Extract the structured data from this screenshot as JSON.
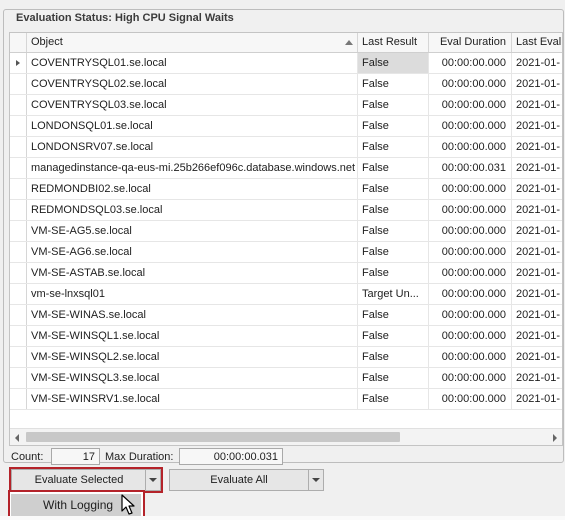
{
  "group": {
    "title": "Evaluation Status: High CPU Signal Waits"
  },
  "grid": {
    "columns": {
      "object": "Object",
      "last_result": "Last Result",
      "eval_duration": "Eval Duration",
      "last_eval": "Last Eval"
    },
    "rows": [
      {
        "object": "COVENTRYSQL01.se.local",
        "last_result": "False",
        "eval_duration": "00:00:00.000",
        "last_eval": "2021-01-"
      },
      {
        "object": "COVENTRYSQL02.se.local",
        "last_result": "False",
        "eval_duration": "00:00:00.000",
        "last_eval": "2021-01-"
      },
      {
        "object": "COVENTRYSQL03.se.local",
        "last_result": "False",
        "eval_duration": "00:00:00.000",
        "last_eval": "2021-01-"
      },
      {
        "object": "LONDONSQL01.se.local",
        "last_result": "False",
        "eval_duration": "00:00:00.000",
        "last_eval": "2021-01-"
      },
      {
        "object": "LONDONSRV07.se.local",
        "last_result": "False",
        "eval_duration": "00:00:00.000",
        "last_eval": "2021-01-"
      },
      {
        "object": "managedinstance-qa-eus-mi.25b266ef096c.database.windows.net",
        "last_result": "False",
        "eval_duration": "00:00:00.031",
        "last_eval": "2021-01-"
      },
      {
        "object": "REDMONDBI02.se.local",
        "last_result": "False",
        "eval_duration": "00:00:00.000",
        "last_eval": "2021-01-"
      },
      {
        "object": "REDMONDSQL03.se.local",
        "last_result": "False",
        "eval_duration": "00:00:00.000",
        "last_eval": "2021-01-"
      },
      {
        "object": "VM-SE-AG5.se.local",
        "last_result": "False",
        "eval_duration": "00:00:00.000",
        "last_eval": "2021-01-"
      },
      {
        "object": "VM-SE-AG6.se.local",
        "last_result": "False",
        "eval_duration": "00:00:00.000",
        "last_eval": "2021-01-"
      },
      {
        "object": "VM-SE-ASTAB.se.local",
        "last_result": "False",
        "eval_duration": "00:00:00.000",
        "last_eval": "2021-01-"
      },
      {
        "object": "vm-se-lnxsql01",
        "last_result": "Target Un...",
        "eval_duration": "00:00:00.000",
        "last_eval": "2021-01-"
      },
      {
        "object": "VM-SE-WINAS.se.local",
        "last_result": "False",
        "eval_duration": "00:00:00.000",
        "last_eval": "2021-01-"
      },
      {
        "object": "VM-SE-WINSQL1.se.local",
        "last_result": "False",
        "eval_duration": "00:00:00.000",
        "last_eval": "2021-01-"
      },
      {
        "object": "VM-SE-WINSQL2.se.local",
        "last_result": "False",
        "eval_duration": "00:00:00.000",
        "last_eval": "2021-01-"
      },
      {
        "object": "VM-SE-WINSQL3.se.local",
        "last_result": "False",
        "eval_duration": "00:00:00.000",
        "last_eval": "2021-01-"
      },
      {
        "object": "VM-SE-WINSRV1.se.local",
        "last_result": "False",
        "eval_duration": "00:00:00.000",
        "last_eval": "2021-01-"
      }
    ],
    "focused_row": 0
  },
  "footer": {
    "count_label": "Count:",
    "count_value": "17",
    "max_label": "Max Duration:",
    "max_value": "00:00:00.031"
  },
  "buttons": {
    "evaluate_selected": "Evaluate Selected",
    "evaluate_all": "Evaluate All"
  },
  "dropdown_menu": {
    "with_logging": "With Logging"
  },
  "colors": {
    "highlight": "#b4232a",
    "selected_cell": "#dcdcdc"
  },
  "icons": [
    "sort-ascending-icon",
    "row-indicator-icon",
    "chevron-down-icon",
    "scroll-left-icon",
    "scroll-right-icon",
    "mouse-pointer-icon"
  ]
}
